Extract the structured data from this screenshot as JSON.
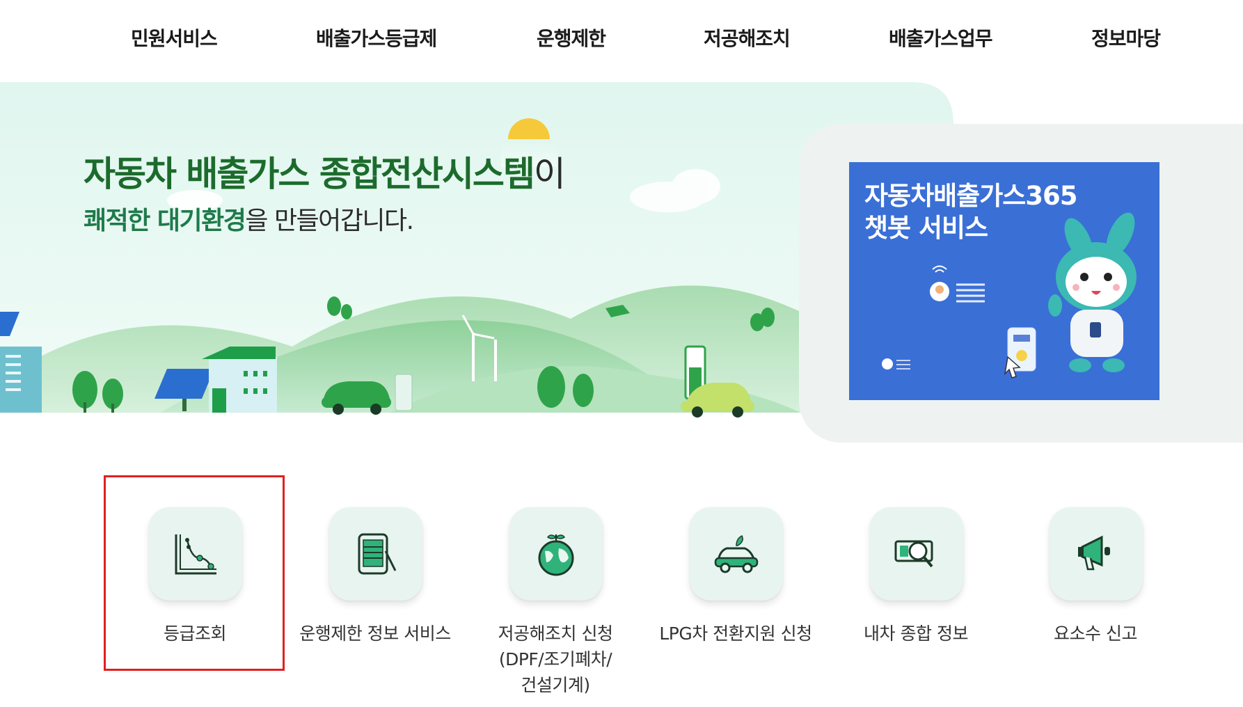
{
  "nav": {
    "items": [
      "민원서비스",
      "배출가스등급제",
      "운행제한",
      "저공해조치",
      "배출가스업무",
      "정보마당"
    ]
  },
  "hero": {
    "title_bold": "자동차 배출가스 종합전산시스템",
    "title_tail": "이",
    "subtitle_bold": "쾌적한 대기환경",
    "subtitle_tail": "을 만들어갑니다."
  },
  "banner": {
    "line1": "자동차배출가스365",
    "line2": "챗봇 서비스",
    "bg_color": "#3a6fd6"
  },
  "quick_menu": {
    "items": [
      {
        "label": "등급조회",
        "icon": "chart-graph-icon",
        "selected": true
      },
      {
        "label": "운행제한 정보 서비스",
        "icon": "tablet-pen-icon"
      },
      {
        "label_lines": [
          "저공해조치 신청",
          "(DPF/조기폐차/",
          "건설기계)"
        ],
        "icon": "eco-globe-icon"
      },
      {
        "label": "LPG차 전환지원 신청",
        "icon": "eco-car-icon"
      },
      {
        "label": "내차 종합 정보",
        "icon": "money-search-icon"
      },
      {
        "label": "요소수 신고",
        "icon": "megaphone-icon"
      }
    ],
    "tile_color": "#e8f4ef",
    "icon_color": "#1c3a2a",
    "accent_color": "#2fb37a",
    "highlight_color": "#e02020"
  }
}
